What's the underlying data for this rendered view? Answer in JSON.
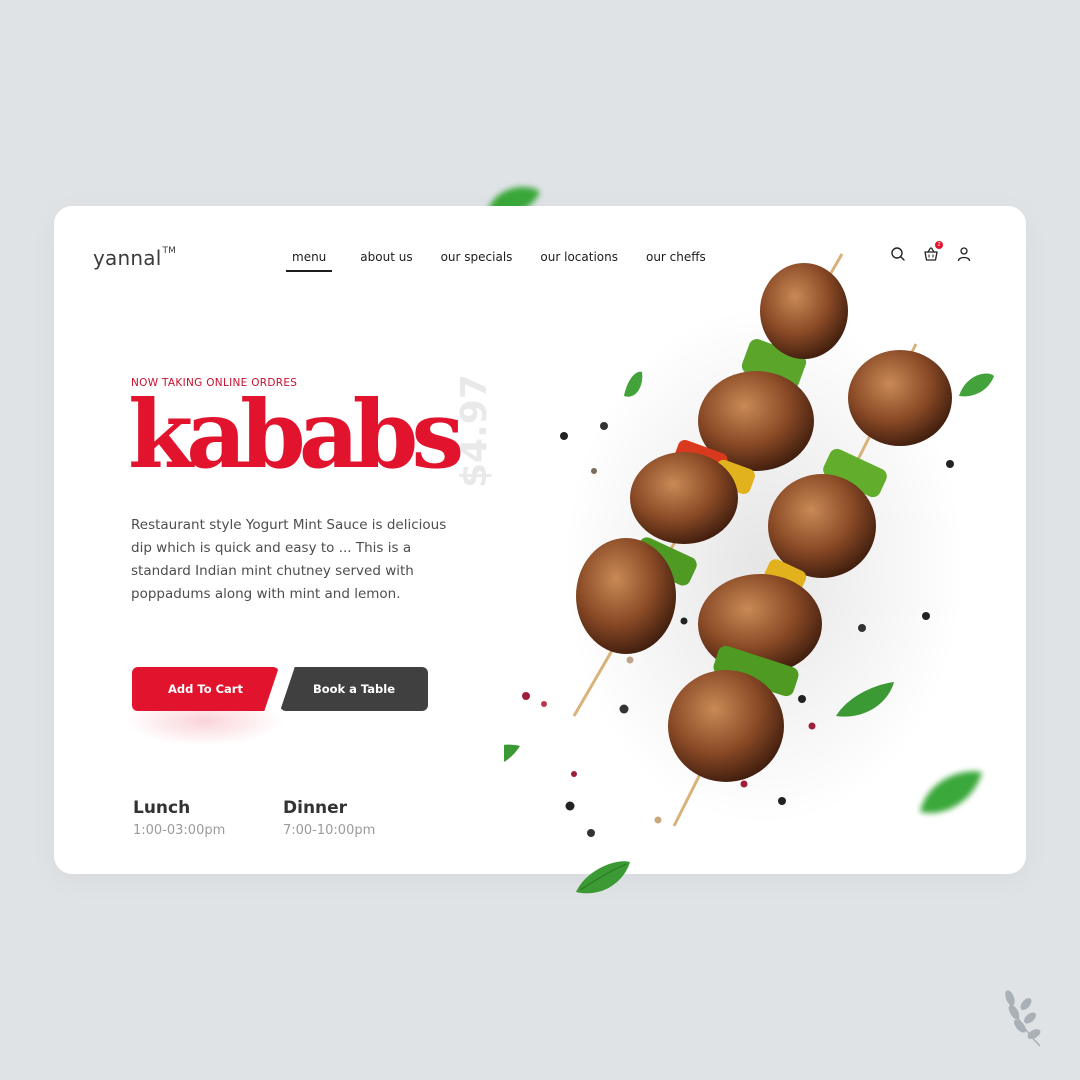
{
  "brand": {
    "name": "yannal",
    "trademark": "TM"
  },
  "nav": {
    "items": [
      {
        "label": "menu",
        "active": true
      },
      {
        "label": "about us",
        "active": false
      },
      {
        "label": "our specials",
        "active": false
      },
      {
        "label": "our locations",
        "active": false
      },
      {
        "label": "our cheffs",
        "active": false
      }
    ]
  },
  "header_icons": {
    "search": "search-icon",
    "cart": "basket-icon",
    "cart_count": "2",
    "account": "user-icon"
  },
  "hero": {
    "eyebrow": "NOW TAKING ONLINE ORDRES",
    "title": "kababs",
    "price": "$4.97",
    "description": "Restaurant style Yogurt Mint Sauce is delicious dip which is quick and easy to ... This is a standard Indian mint chutney served with poppadums along with mint and lemon."
  },
  "actions": {
    "add_to_cart": "Add To Cart",
    "book_table": "Book a Table"
  },
  "hours": {
    "lunch": {
      "label": "Lunch",
      "time": "1:00-03:00pm"
    },
    "dinner": {
      "label": "Dinner",
      "time": "7:00-10:00pm"
    }
  },
  "colors": {
    "accent": "#e1132d",
    "dark_button": "#404040",
    "background": "#dfe3e6",
    "card": "#ffffff"
  }
}
